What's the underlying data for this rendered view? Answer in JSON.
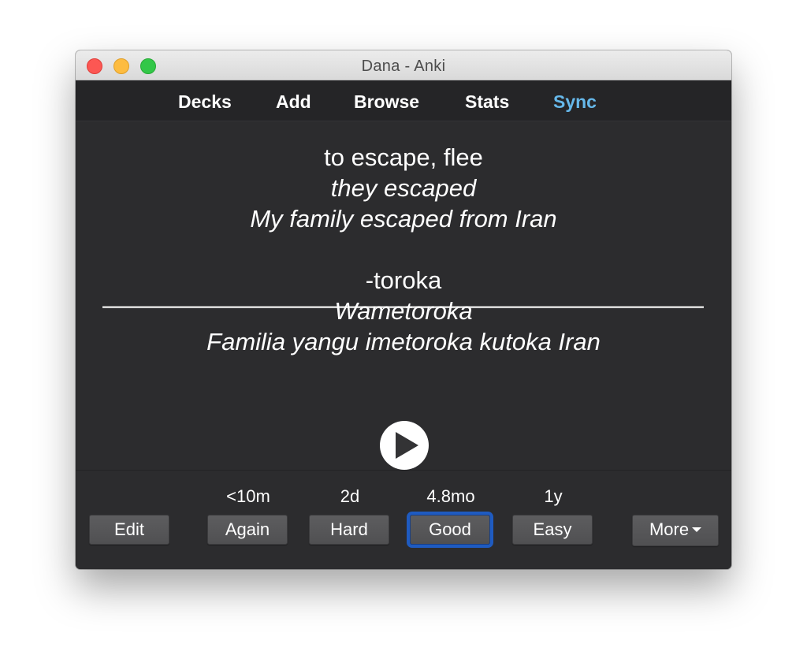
{
  "window": {
    "title": "Dana - Anki",
    "traffic_lights": [
      "close",
      "minimize",
      "zoom"
    ]
  },
  "toolbar": {
    "items": [
      {
        "label": "Decks",
        "active": false
      },
      {
        "label": "Add",
        "active": false
      },
      {
        "label": "Browse",
        "active": false
      },
      {
        "label": "Stats",
        "active": false
      },
      {
        "label": "Sync",
        "active": true
      }
    ],
    "active_color": "#66b8ea"
  },
  "card": {
    "front": {
      "word": "to escape, flee",
      "conjugation": "they escaped",
      "example": "My family escaped from Iran"
    },
    "back": {
      "word": "-toroka",
      "conjugation": "Wametoroka",
      "example": "Familia yangu imetoroka kutoka Iran"
    },
    "audio_icon": "play-icon"
  },
  "answer_bar": {
    "edit_label": "Edit",
    "more_label": "More",
    "buttons": [
      {
        "label": "Again",
        "interval": "<10m",
        "focused": false
      },
      {
        "label": "Hard",
        "interval": "2d",
        "focused": false
      },
      {
        "label": "Good",
        "interval": "4.8mo",
        "focused": true
      },
      {
        "label": "Easy",
        "interval": "1y",
        "focused": false
      }
    ],
    "focus_color": "#1f5bc0"
  }
}
